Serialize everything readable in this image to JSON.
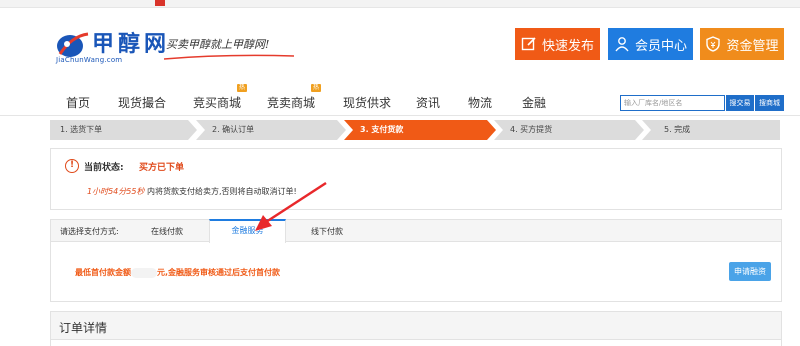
{
  "brand": {
    "name": "甲醇网",
    "domain": "JiaChunWang.com",
    "slogan": "买卖甲醇就上甲醇网!"
  },
  "header_buttons": {
    "publish": "快速发布",
    "member": "会员中心",
    "funds": "资金管理"
  },
  "nav": {
    "items": [
      {
        "label": "首页"
      },
      {
        "label": "现货撮合"
      },
      {
        "label": "竞买商城",
        "badge": "热"
      },
      {
        "label": "竞卖商城",
        "badge": "热"
      },
      {
        "label": "现货供求"
      },
      {
        "label": "资讯"
      },
      {
        "label": "物流"
      },
      {
        "label": "金融"
      }
    ],
    "search_placeholder": "输入厂库名/地区名",
    "search_trade": "搜交易",
    "search_mall": "搜商城"
  },
  "steps": [
    {
      "label": "1. 选货下单"
    },
    {
      "label": "2. 确认订单"
    },
    {
      "label": "3. 支付货款",
      "active": true
    },
    {
      "label": "4. 买方提货"
    },
    {
      "label": "5. 完成"
    }
  ],
  "status": {
    "label": "当前状态:",
    "value": "买方已下单",
    "countdown": "1小时54分55秒",
    "countdown_text": "内将货款支付给卖方,否则将自动取消订单!"
  },
  "payment": {
    "label": "请选择支付方式:",
    "tabs": [
      "在线付款",
      "金融服务",
      "线下付款"
    ],
    "active_tab": "金融服务",
    "message_prefix": "最低首付款金额",
    "message_suffix": "元,金融服务审核通过后支付首付款",
    "apply_button": "申请融资"
  },
  "order_detail": {
    "title": "订单详情"
  },
  "colors": {
    "orange": "#f05a16",
    "blue": "#1f7ce0",
    "funds_orange": "#f08c1c",
    "step_active": "#f05a16",
    "step_inactive": "#dcdcdc",
    "annotation_red": "#e8282b"
  }
}
